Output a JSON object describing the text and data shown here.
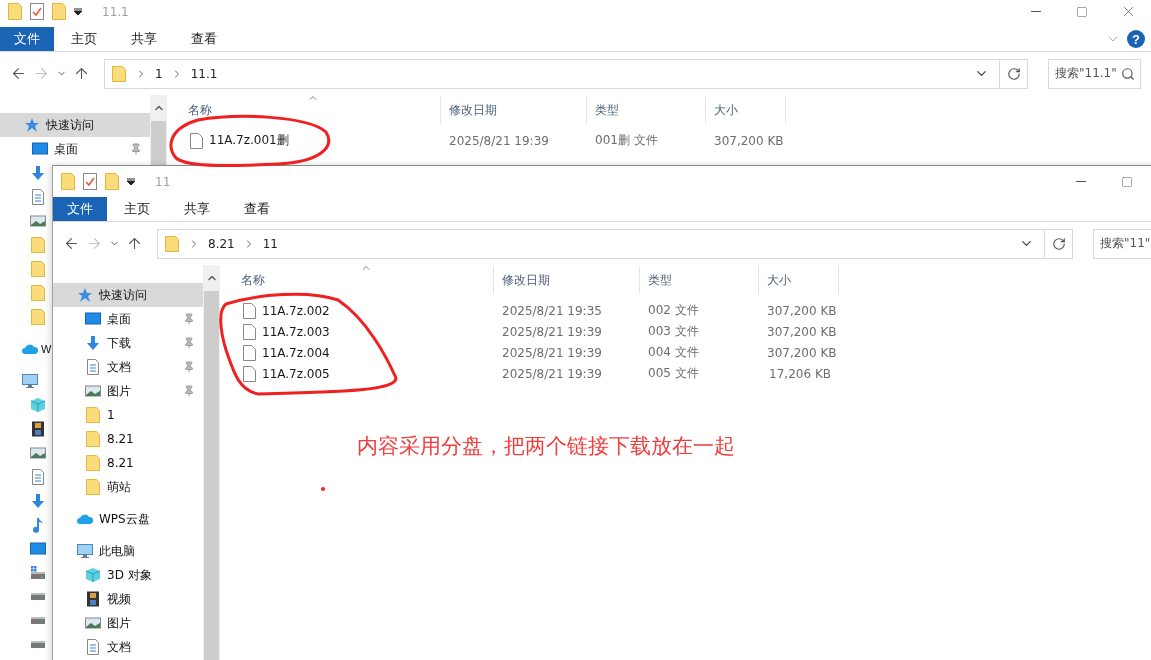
{
  "windows": [
    {
      "title": "11.1",
      "file_menu": "文件",
      "tabs": [
        "主页",
        "共享",
        "查看"
      ],
      "help": "?",
      "path": [
        "1",
        "11.1"
      ],
      "search": {
        "placeholder": "搜索\"11.1\""
      },
      "sidebar": [
        {
          "kind": "star",
          "label": "快速访问",
          "selected": true,
          "children": [
            {
              "kind": "desktop",
              "label": "桌面",
              "pinned": true,
              "selected": false
            },
            {
              "kind": "download"
            },
            {
              "kind": "doc"
            },
            {
              "kind": "picture"
            },
            {
              "kind": "folder"
            },
            {
              "kind": "folder"
            },
            {
              "kind": "folder"
            },
            {
              "kind": "folder"
            }
          ]
        },
        {
          "kind": "cloud",
          "label": "W"
        },
        {
          "kind": "pc",
          "children": [
            {
              "kind": "cube"
            },
            {
              "kind": "film"
            },
            {
              "kind": "picture"
            },
            {
              "kind": "doc"
            },
            {
              "kind": "download"
            },
            {
              "kind": "music"
            },
            {
              "kind": "desktop"
            },
            {
              "kind": "drive-win"
            },
            {
              "kind": "drive"
            },
            {
              "kind": "drive"
            },
            {
              "kind": "drive"
            }
          ]
        }
      ],
      "columns": [
        "名称",
        "修改日期",
        "类型",
        "大小"
      ],
      "files": [
        {
          "name": "11A.7z.001删",
          "modified": "2025/8/21 19:39",
          "type": "001删 文件",
          "size": "307,200 KB"
        }
      ]
    },
    {
      "title": "11",
      "file_menu": "文件",
      "tabs": [
        "主页",
        "共享",
        "查看"
      ],
      "path": [
        "8.21",
        "11"
      ],
      "search": {
        "placeholder": "搜索\"11\""
      },
      "sidebar": [
        {
          "kind": "star",
          "label": "快速访问",
          "selected": true,
          "children": [
            {
              "kind": "desktop",
              "label": "桌面",
              "pinned": true,
              "selected": false
            },
            {
              "kind": "download",
              "label": "下载",
              "pinned": true,
              "selected": false
            },
            {
              "kind": "doc",
              "label": "文档",
              "pinned": true,
              "selected": false
            },
            {
              "kind": "picture",
              "label": "图片",
              "pinned": true,
              "selected": false
            },
            {
              "kind": "folder",
              "label": "1",
              "pinned": false,
              "selected": false
            },
            {
              "kind": "folder",
              "label": "8.21",
              "pinned": false,
              "selected": false
            },
            {
              "kind": "folder",
              "label": "8.21",
              "pinned": false,
              "selected": false
            },
            {
              "kind": "folder",
              "label": "萌站",
              "pinned": false,
              "selected": false
            }
          ]
        },
        {
          "kind": "cloud",
          "label": "WPS云盘",
          "selected": false
        },
        {
          "kind": "pc",
          "label": "此电脑",
          "selected": false,
          "children": [
            {
              "kind": "cube",
              "label": "3D 对象",
              "selected": false
            },
            {
              "kind": "film",
              "label": "视频",
              "selected": false
            },
            {
              "kind": "picture",
              "label": "图片",
              "selected": false
            },
            {
              "kind": "doc",
              "label": "文档",
              "selected": false
            }
          ]
        }
      ],
      "columns": [
        "名称",
        "修改日期",
        "类型",
        "大小"
      ],
      "files": [
        {
          "name": "11A.7z.002",
          "modified": "2025/8/21 19:35",
          "type": "002 文件",
          "size": "307,200 KB"
        },
        {
          "name": "11A.7z.003",
          "modified": "2025/8/21 19:39",
          "type": "003 文件",
          "size": "307,200 KB"
        },
        {
          "name": "11A.7z.004",
          "modified": "2025/8/21 19:39",
          "type": "004 文件",
          "size": "307,200 KB"
        },
        {
          "name": "11A.7z.005",
          "modified": "2025/8/21 19:39",
          "type": "005 文件",
          "size": "17,206 KB"
        }
      ]
    }
  ],
  "annotation": {
    "text": "内容采用分盘，把两个链接下载放在一起"
  }
}
